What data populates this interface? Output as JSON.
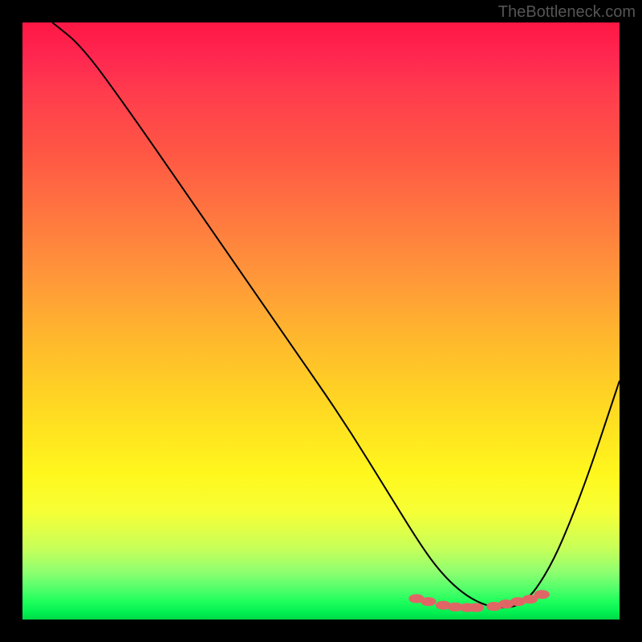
{
  "watermark": "TheBottleneck.com",
  "chart_data": {
    "type": "line",
    "title": "",
    "xlabel": "",
    "ylabel": "",
    "xlim": [
      0,
      100
    ],
    "ylim": [
      0,
      100
    ],
    "series": [
      {
        "name": "bottleneck-curve",
        "x": [
          5,
          10,
          18,
          27,
          36,
          45,
          54,
          62,
          67,
          70,
          73,
          76,
          79,
          82,
          84,
          86,
          89,
          92,
          95,
          98,
          100
        ],
        "y": [
          100,
          96,
          85,
          72,
          59,
          46,
          33,
          20,
          12,
          8,
          5,
          3,
          2,
          2,
          3,
          5,
          10,
          17,
          25,
          34,
          40
        ]
      }
    ],
    "markers": {
      "name": "optimal-zone-dots",
      "x": [
        66,
        68,
        70.5,
        72.5,
        74.5,
        76,
        79,
        81,
        83,
        85,
        87
      ],
      "y": [
        3.5,
        3.0,
        2.4,
        2.1,
        2.0,
        2.0,
        2.2,
        2.6,
        3.0,
        3.4,
        4.2
      ]
    },
    "colors": {
      "curve": "#000000",
      "marker": "#e06666",
      "gradient_top": "#ff1744",
      "gradient_bottom": "#00d646"
    }
  }
}
